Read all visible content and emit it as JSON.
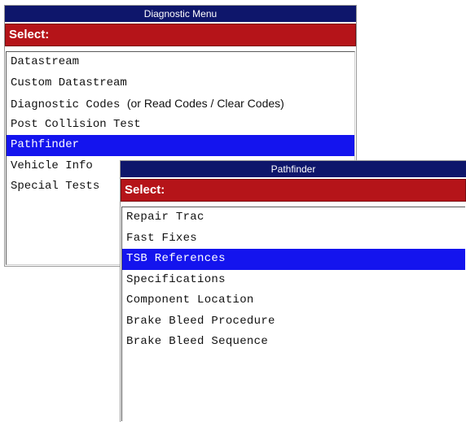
{
  "diagnostic_menu": {
    "title": "Diagnostic Menu",
    "select_label": "Select:",
    "items": [
      {
        "label": "Datastream"
      },
      {
        "label": "Custom Datastream"
      },
      {
        "label": "Diagnostic Codes",
        "note": "(or Read Codes / Clear Codes)"
      },
      {
        "label": "Post Collision Test"
      },
      {
        "label": "Pathfinder",
        "selected": true
      },
      {
        "label": "Vehicle Info"
      },
      {
        "label": "Special Tests"
      }
    ]
  },
  "pathfinder_menu": {
    "title": "Pathfinder",
    "select_label": "Select:",
    "items": [
      {
        "label": "Repair Trac"
      },
      {
        "label": "Fast Fixes"
      },
      {
        "label": "TSB References",
        "selected": true
      },
      {
        "label": "Specifications"
      },
      {
        "label": "Component Location"
      },
      {
        "label": "Brake Bleed Procedure"
      },
      {
        "label": "Brake Bleed Sequence"
      }
    ]
  },
  "colors": {
    "title_bar": "#0e166b",
    "select_bar": "#b51419",
    "highlight": "#1414ee"
  }
}
